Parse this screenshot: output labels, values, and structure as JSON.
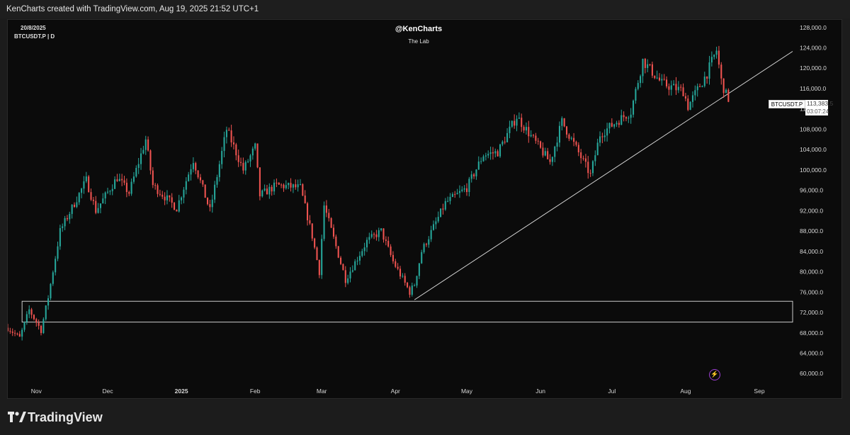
{
  "header": {
    "attribution": "KenCharts created with TradingView.com, Aug 19, 2025 21:52 UTC+1"
  },
  "chart_meta": {
    "date": "20/8/2025",
    "symbol": "BTCUSDT.P | D"
  },
  "watermark": {
    "title": "@KenCharts",
    "subtitle": "The Lab"
  },
  "price_label": {
    "symbol": "BTCUSDT.P",
    "price": "113,383.5",
    "countdown": "03:07:24"
  },
  "footer": {
    "brand": "TradingView"
  },
  "colors": {
    "up": "#26a69a",
    "down": "#ef5350",
    "background": "#0b0b0b",
    "text": "#d8d8d8",
    "drawing": "#e0e0e0"
  },
  "icons": {
    "bolt": "lightning-bolt-icon",
    "logo": "tradingview-logo-icon"
  },
  "chart_data": {
    "type": "candlestick",
    "title": "@KenCharts",
    "subtitle": "The Lab",
    "symbol": "BTCUSDT.P",
    "interval": "D",
    "y_axis": {
      "side": "right",
      "ylim": [
        58500,
        129500
      ],
      "ticks": [
        128000,
        124000,
        120000,
        116000,
        112000,
        108000,
        104000,
        100000,
        96000,
        92000,
        88000,
        84000,
        80000,
        76000,
        72000,
        68000,
        64000,
        60000
      ],
      "tick_labels": [
        "128,000.0",
        "124,000.0",
        "120,000.0",
        "116,000.0",
        "112,000.0",
        "108,000.0",
        "104,000.0",
        "100,000.0",
        "96,000.0",
        "92,000.0",
        "88,000.0",
        "84,000.0",
        "80,000.0",
        "76,000.0",
        "72,000.0",
        "68,000.0",
        "64,000.0",
        "60,000.0"
      ]
    },
    "x_axis": {
      "xlim": [
        "2024-10-20",
        "2025-09-15"
      ],
      "ticks": [
        {
          "date": "2024-11-01",
          "label": "Nov",
          "bold": false
        },
        {
          "date": "2024-12-01",
          "label": "Dec",
          "bold": false
        },
        {
          "date": "2025-01-01",
          "label": "2025",
          "bold": true
        },
        {
          "date": "2025-02-01",
          "label": "Feb",
          "bold": false
        },
        {
          "date": "2025-03-01",
          "label": "Mar",
          "bold": false
        },
        {
          "date": "2025-04-01",
          "label": "Apr",
          "bold": false
        },
        {
          "date": "2025-05-01",
          "label": "May",
          "bold": false
        },
        {
          "date": "2025-06-01",
          "label": "Jun",
          "bold": false
        },
        {
          "date": "2025-07-01",
          "label": "Jul",
          "bold": false
        },
        {
          "date": "2025-08-01",
          "label": "Aug",
          "bold": false
        },
        {
          "date": "2025-09-01",
          "label": "Sep",
          "bold": false
        }
      ]
    },
    "grid": false,
    "price_path": [
      [
        "2024-10-20",
        69000
      ],
      [
        "2024-10-25",
        67000
      ],
      [
        "2024-10-29",
        72500
      ],
      [
        "2024-11-03",
        68500
      ],
      [
        "2024-11-06",
        75000
      ],
      [
        "2024-11-11",
        88000
      ],
      [
        "2024-11-22",
        98000
      ],
      [
        "2024-11-26",
        92000
      ],
      [
        "2024-12-05",
        98500
      ],
      [
        "2024-12-10",
        95500
      ],
      [
        "2024-12-17",
        106000
      ],
      [
        "2024-12-20",
        97000
      ],
      [
        "2024-12-30",
        92500
      ],
      [
        "2025-01-06",
        102000
      ],
      [
        "2025-01-13",
        92000
      ],
      [
        "2025-01-20",
        108000
      ],
      [
        "2025-01-27",
        100000
      ],
      [
        "2025-02-01",
        104500
      ],
      [
        "2025-02-03",
        95000
      ],
      [
        "2025-02-10",
        97000
      ],
      [
        "2025-02-20",
        96500
      ],
      [
        "2025-02-25",
        87000
      ],
      [
        "2025-02-28",
        80000
      ],
      [
        "2025-03-02",
        93000
      ],
      [
        "2025-03-11",
        78500
      ],
      [
        "2025-03-20",
        86000
      ],
      [
        "2025-03-26",
        88000
      ],
      [
        "2025-03-31",
        82000
      ],
      [
        "2025-04-07",
        76000
      ],
      [
        "2025-04-09",
        77500
      ],
      [
        "2025-04-12",
        84000
      ],
      [
        "2025-04-22",
        93500
      ],
      [
        "2025-05-01",
        96500
      ],
      [
        "2025-05-08",
        103000
      ],
      [
        "2025-05-14",
        103500
      ],
      [
        "2025-05-22",
        110500
      ],
      [
        "2025-06-05",
        101500
      ],
      [
        "2025-06-10",
        109500
      ],
      [
        "2025-06-22",
        99000
      ],
      [
        "2025-06-26",
        107000
      ],
      [
        "2025-07-03",
        109500
      ],
      [
        "2025-07-09",
        111500
      ],
      [
        "2025-07-14",
        121500
      ],
      [
        "2025-07-22",
        117000
      ],
      [
        "2025-07-31",
        115500
      ],
      [
        "2025-08-02",
        112500
      ],
      [
        "2025-08-10",
        119000
      ],
      [
        "2025-08-14",
        123500
      ],
      [
        "2025-08-16",
        117500
      ],
      [
        "2025-08-19",
        113383.5
      ]
    ],
    "drawings": [
      {
        "type": "trendline",
        "from": [
          "2025-04-09",
          74500
        ],
        "to": [
          "2025-09-15",
          123300
        ]
      },
      {
        "type": "rectangle",
        "from": [
          "2024-10-26",
          74200
        ],
        "to": [
          "2025-09-15",
          70100
        ]
      }
    ],
    "last_price": 113383.5
  }
}
